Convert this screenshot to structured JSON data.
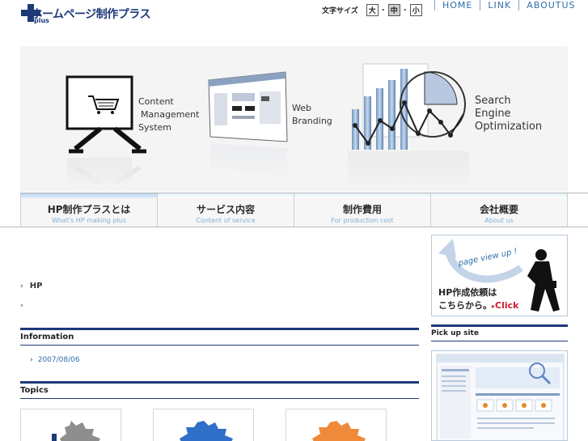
{
  "header": {
    "logo_text": "ホームページ制作プラス",
    "logo_sub": "plus",
    "font_size_label": "文字サイズ",
    "font_sizes": [
      "大",
      "中",
      "小"
    ],
    "font_size_selected": "中",
    "top_links": [
      "HOME",
      "LINK",
      "ABOUTUS"
    ]
  },
  "hero": {
    "cms_label": [
      "Content",
      "Management",
      "System"
    ],
    "web_label": [
      "Web",
      "Branding"
    ],
    "seo_label": [
      "Search",
      "Engine",
      "Optimization"
    ]
  },
  "main_nav": [
    {
      "jp": "HP制作プラスとは",
      "en": "What's HP making plus"
    },
    {
      "jp": "サービス内容",
      "en": "Content of service"
    },
    {
      "jp": "制作費用",
      "en": "For production cost"
    },
    {
      "jp": "会社概要",
      "en": "About us"
    }
  ],
  "breadcrumb": {
    "first": "HP",
    "second": ""
  },
  "information": {
    "title": "Information",
    "items": [
      {
        "date": "2007/08/06"
      }
    ]
  },
  "topics": {
    "title": "Topics"
  },
  "sidebar": {
    "banner_badge": "page view up !",
    "banner_line1": "HP作成依頼は",
    "banner_line2": "こちらから。",
    "banner_click": "Click",
    "pickup_title": "Pick up site"
  },
  "colors": {
    "navy": "#1d3a78",
    "link_blue": "#2e6fa8",
    "click_red": "#cc1f2f"
  }
}
